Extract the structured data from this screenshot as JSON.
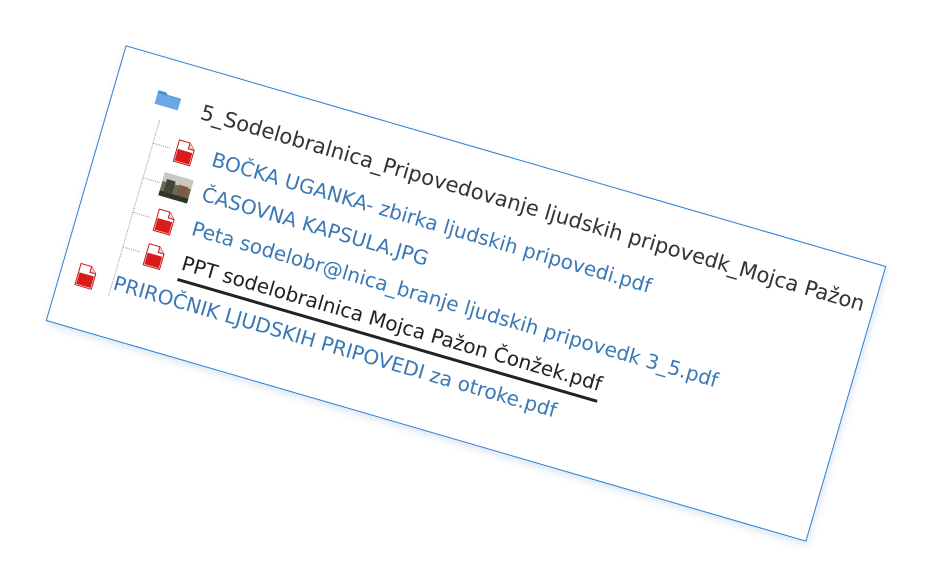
{
  "tree": {
    "folder": {
      "label": "5_Sodelobralnica_Pripovedovanje ljudskih pripovedk_Mojca Pažon",
      "icon": "folder-icon"
    },
    "files": [
      {
        "label": "BOČKA UGANKA- zbirka ljudskih pripovedi.pdf",
        "icon": "pdf-icon",
        "selected": false
      },
      {
        "label": "ČASOVNA KAPSULA.JPG",
        "icon": "image-thumbnail-icon",
        "selected": false
      },
      {
        "label": "Peta sodelobr@lnica_branje ljudskih pripovedk 3_5.pdf",
        "icon": "pdf-icon",
        "selected": false
      },
      {
        "label": "PPT sodelobralnica Mojca Pažon Čonžek.pdf",
        "icon": "pdf-icon",
        "selected": true
      }
    ],
    "sibling": {
      "label": "PRIROČNIK LJUDSKIH PRIPOVEDI za otroke.pdf",
      "icon": "pdf-icon"
    }
  },
  "colors": {
    "link": "#3b78b6",
    "selected_text": "#222222",
    "frame_border": "#2b7fd0",
    "pdf_red": "#d81b1b",
    "folder_blue": "#4a8fd6"
  }
}
